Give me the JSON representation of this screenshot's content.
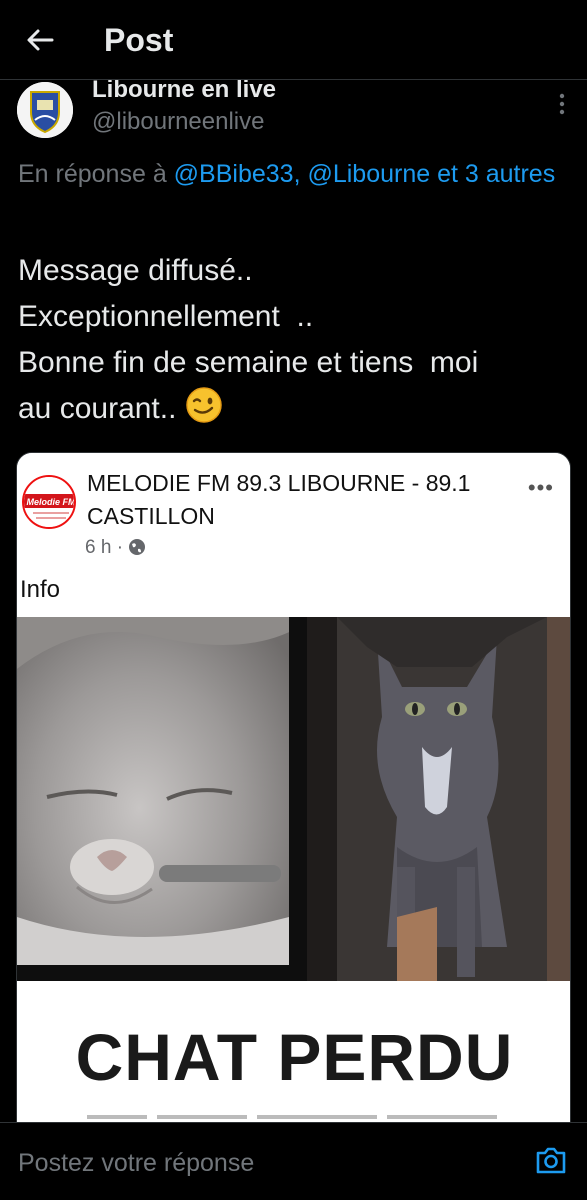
{
  "header": {
    "title": "Post"
  },
  "author": {
    "name": "Libourne en live",
    "handle": "@libourneenlive"
  },
  "reply": {
    "prefix": "En réponse à ",
    "mentions": "@BBibe33, @Libourne et 3 autres"
  },
  "tweet_lines": [
    "Message diffusé..",
    "Exceptionnellement  ..",
    "Bonne fin de semaine et tiens  moi",
    "au courant.. "
  ],
  "embedded_post": {
    "page_name": "MELODIE FM  89.3 LIBOURNE - 89.1 CASTILLON",
    "time": "6 h ·",
    "text": "Info",
    "banner_title": "CHAT PERDU",
    "logo_text": "Melodie FM"
  },
  "composer": {
    "placeholder": "Postez votre réponse"
  },
  "icons": {
    "back": "arrow-left-icon",
    "more": "more-vertical-icon",
    "camera": "camera-icon",
    "globe": "globe-icon",
    "wink": "winking-face-emoji"
  },
  "colors": {
    "background": "#000000",
    "accent": "#1d9bf0",
    "muted": "#71767b",
    "text": "#e7e9ea"
  }
}
